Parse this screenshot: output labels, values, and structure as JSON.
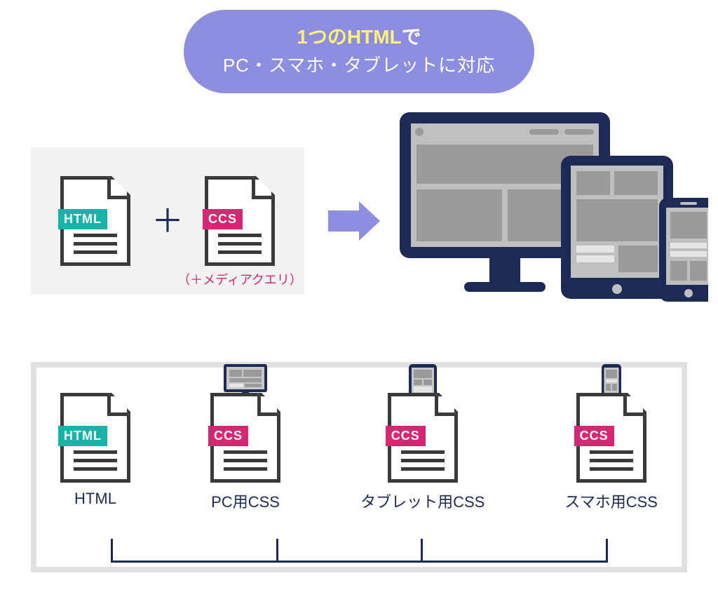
{
  "title": {
    "emphasis": "1つのHTML",
    "line1_rest": "で",
    "line2": "PC・スマホ・タブレットに対応"
  },
  "equation": {
    "html_badge": "HTML",
    "plus": "＋",
    "ccs_badge": "CCS",
    "media_query_note": "（＋メディアクエリ）"
  },
  "devices": {
    "desktop": "desktop-icon",
    "tablet": "tablet-icon",
    "phone": "phone-icon"
  },
  "bottom": {
    "columns": [
      {
        "badge_text": "HTML",
        "badge_kind": "html",
        "caption": "HTML",
        "mini": null
      },
      {
        "badge_text": "CCS",
        "badge_kind": "ccs",
        "caption": "PC用CSS",
        "mini": "desktop"
      },
      {
        "badge_text": "CCS",
        "badge_kind": "ccs",
        "caption": "タブレット用CSS",
        "mini": "tablet"
      },
      {
        "badge_text": "CCS",
        "badge_kind": "ccs",
        "caption": "スマホ用CSS",
        "mini": "phone"
      }
    ]
  },
  "colors": {
    "pill": "#8D8EE0",
    "accent_yellow": "#FFF176",
    "html_badge": "#18B2A6",
    "ccs_badge": "#D62872",
    "ink": "#1E2A56"
  }
}
